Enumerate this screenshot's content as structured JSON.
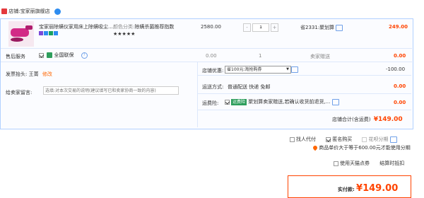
{
  "shop": {
    "prefix": "店铺:",
    "name": "宝家丽旗舰店"
  },
  "item": {
    "title": "宝家丽除螨仪家用床上除螨吸尘...",
    "sku_label": "颜色分类:",
    "sku_value": "除螨杀菌推荐指数★★★★★",
    "price": "2580.00",
    "qty": "1",
    "promo": "省2331:聚划算",
    "subtotal": "249.00"
  },
  "service": {
    "label": "售后服务",
    "name": "全国联保",
    "price": "0.00",
    "qty": "1",
    "bear": "卖家赠送",
    "sum": "0.00"
  },
  "invoice": {
    "label": "发票抬头:",
    "name": "王菁",
    "edit": "修改"
  },
  "message": {
    "label": "给卖家留言:",
    "placeholder": "选填:对本次交易的说明(建议填写已和卖家协商一致的内容)"
  },
  "coupon": {
    "label": "店铺优惠:",
    "selected": "省100元:淘抢购券",
    "amount": "-100.00"
  },
  "shipping": {
    "label": "运送方式:",
    "value": "普通配送 快递 免邮",
    "amount": "0.00"
  },
  "insurance": {
    "label": "运费险:",
    "badge": "运费险",
    "text": "聚划算卖家赠送,若确认收货前退货,...",
    "amount": "0.00"
  },
  "total": {
    "label": "店铺合计(含运费)",
    "amount": "¥149.00"
  },
  "options": {
    "proxy": "找人代付",
    "anon": "匿名购买",
    "huabei": "花呗分期",
    "note": "商品单价大于等于600.00元才能使用分期",
    "tmall_coupon": "使用天猫点券",
    "checkout_discount": "结算时抵扣"
  },
  "pay": {
    "label": "实付款:",
    "amount": "¥149.00"
  }
}
